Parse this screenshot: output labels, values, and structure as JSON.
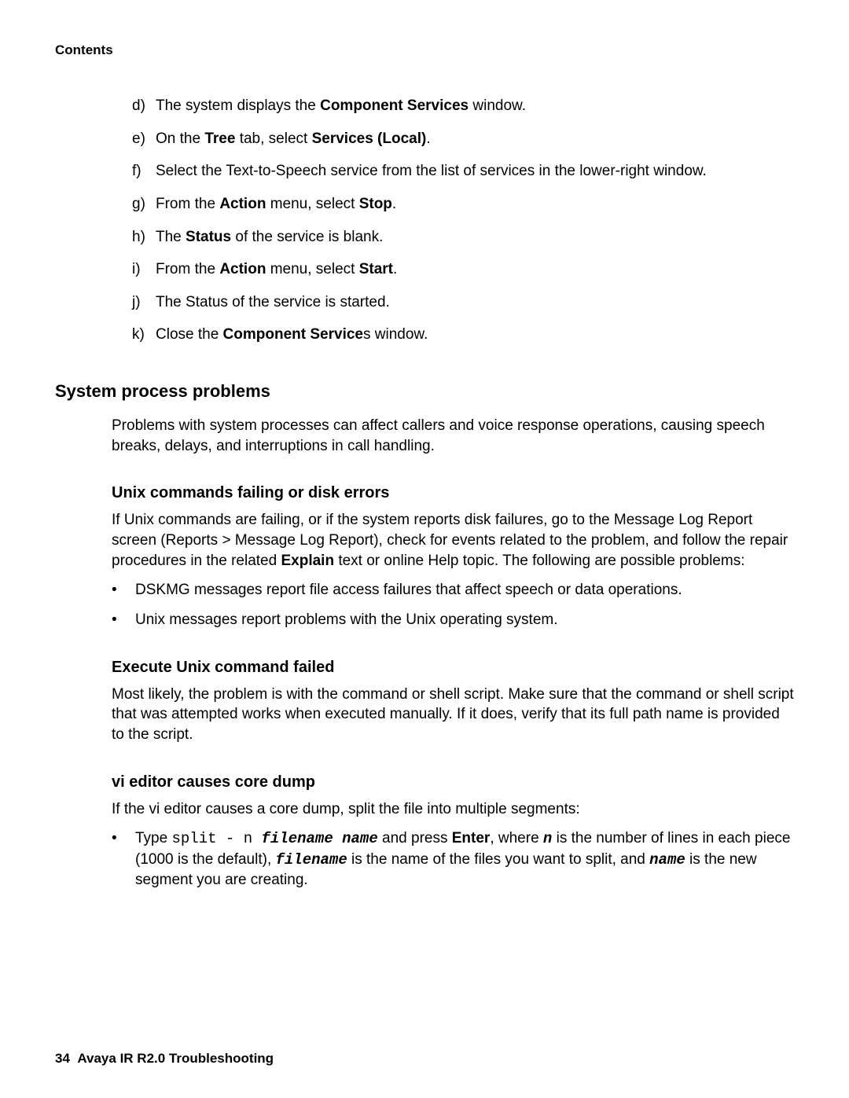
{
  "header": {
    "contents": "Contents"
  },
  "ordered": {
    "d_marker": "d)",
    "d_pre": "The system displays the ",
    "d_bold": "Component Services",
    "d_post": " window.",
    "e_marker": "e)",
    "e_pre": "On the ",
    "e_bold1": "Tree",
    "e_mid": " tab, select ",
    "e_bold2": "Services (Local)",
    "e_post": ".",
    "f_marker": "f)",
    "f_text": "Select the Text-to-Speech service from the list of services in the lower-right window.",
    "g_marker": "g)",
    "g_pre": "From the ",
    "g_bold1": "Action",
    "g_mid": " menu, select ",
    "g_bold2": "Stop",
    "g_post": ".",
    "h_marker": "h)",
    "h_pre": "The ",
    "h_bold": "Status",
    "h_post": " of the service is blank.",
    "i_marker": "i)",
    "i_pre": "From the ",
    "i_bold1": "Action",
    "i_mid": " menu, select ",
    "i_bold2": "Start",
    "i_post": ".",
    "j_marker": "j)",
    "j_text": "The Status of the service is started.",
    "k_marker": "k)",
    "k_pre": "Close the ",
    "k_bold": "Component Service",
    "k_post": "s window."
  },
  "sections": {
    "h2_spp": "System process problems",
    "spp_para": "Problems with system processes can affect callers and voice response operations, causing speech breaks, delays, and interruptions in call handling.",
    "h3_unix_fail": "Unix commands failing or disk errors",
    "unix_fail_pre": "If Unix commands are failing, or if the system reports disk failures, go to the Message Log Report screen (Reports > Message Log Report), check for events related to the problem, and follow the repair procedures in the related ",
    "unix_fail_bold": "Explain",
    "unix_fail_post": " text or online Help topic. The following are possible problems:",
    "bullet1": "DSKMG messages report file access failures that affect speech or data operations.",
    "bullet2": "Unix messages report problems with the Unix operating system.",
    "h3_exec": "Execute Unix command failed",
    "exec_para": "Most likely, the problem is with the command or shell script. Make sure that the command or shell script that was attempted works when executed manually. If it does, verify that its full path name is provided to the script.",
    "h3_vi": "vi editor causes core dump",
    "vi_para": "If the vi editor causes a core dump, split the file into multiple segments:",
    "vi_b_pre": "Type ",
    "vi_b_mono1": "split - n ",
    "vi_b_monoit1": "filename name",
    "vi_b_mid1": " and press ",
    "vi_b_bold1": "Enter",
    "vi_b_mid2": ", where ",
    "vi_b_monoit2": "n",
    "vi_b_mid3": " is the number of lines in each piece (1000 is the default), ",
    "vi_b_monoit3": "filename",
    "vi_b_mid4": " is the name of the files you want to split, and ",
    "vi_b_monoit4": "name",
    "vi_b_post": " is the new segment you are creating."
  },
  "footer": {
    "page_number": "34",
    "title": "Avaya IR R2.0 Troubleshooting"
  }
}
